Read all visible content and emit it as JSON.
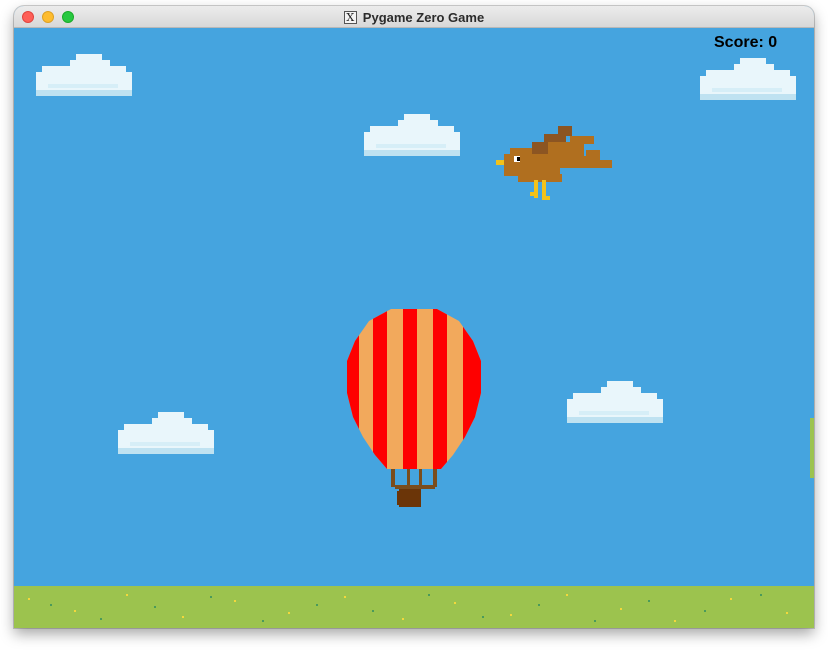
{
  "window": {
    "title": "Pygame Zero Game",
    "x11_icon": "X"
  },
  "game": {
    "score_text": "Score: 0",
    "sprites": [
      "cloud",
      "cloud",
      "cloud",
      "cloud",
      "cloud",
      "bird",
      "hot-air-balloon",
      "grass-ground"
    ]
  },
  "colors": {
    "sky": "#45a4df",
    "grass": "#9cc34e",
    "balloon_red": "#fe0000",
    "balloon_orange": "#f2a95c",
    "bird_brown": "#b06f1f",
    "cloud": "#e9f6fb"
  }
}
